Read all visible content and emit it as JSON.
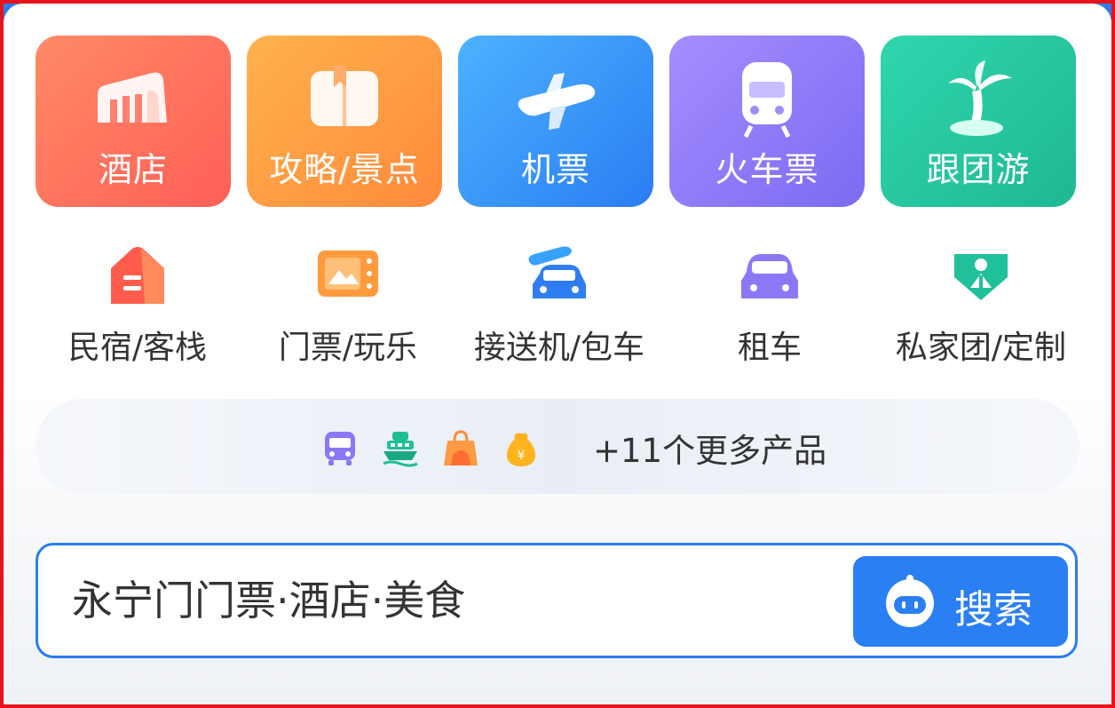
{
  "main_tiles": [
    {
      "label": "酒店",
      "icon": "hotel-building-icon"
    },
    {
      "label": "攻略/景点",
      "icon": "guide-book-icon"
    },
    {
      "label": "机票",
      "icon": "airplane-icon"
    },
    {
      "label": "火车票",
      "icon": "train-icon"
    },
    {
      "label": "跟团游",
      "icon": "palm-tree-icon"
    }
  ],
  "services": [
    {
      "label": "民宿/客栈",
      "icon": "homestay-icon"
    },
    {
      "label": "门票/玩乐",
      "icon": "ticket-icon"
    },
    {
      "label": "接送机/包车",
      "icon": "airport-transfer-icon"
    },
    {
      "label": "租车",
      "icon": "car-rental-icon"
    },
    {
      "label": "私家团/定制",
      "icon": "private-tour-icon"
    }
  ],
  "more_products": {
    "label": "+11个更多产品",
    "icons": [
      "bus-icon",
      "cruise-ship-icon",
      "shopping-bag-icon",
      "money-bag-icon"
    ]
  },
  "search": {
    "placeholder": "永宁门门票·酒店·美食",
    "button_label": "搜索"
  },
  "colors": {
    "accent": "#2a7df2",
    "hotel": "#ff6a5a",
    "guide": "#ff9c43",
    "flight": "#3b95f7",
    "train": "#8f7bf8",
    "tour": "#25c7a0"
  }
}
